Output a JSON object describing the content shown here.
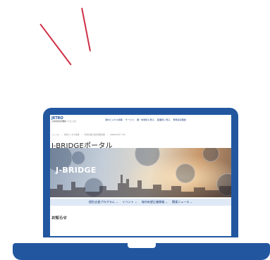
{
  "colors": {
    "accent": "#cf2e45",
    "laptop": "#2257a0",
    "nav_bar": "#dfe9f6"
  },
  "site": {
    "logo_subtitle": "日本貿易振興機構（ジェトロ）",
    "logo_mark": "JETRO",
    "main_nav": [
      "海外ビジネス情報",
      "サービス",
      "国・地域別に見る",
      "産業別に見る",
      "貿易投資相談"
    ],
    "breadcrumb": [
      "ジェトロ",
      "海外ビジネス情報",
      "日本企業の海外展開支援",
      "J-BRIDGEポータル"
    ],
    "page_title": "J-BRIDGEポータル",
    "hero_logo": "J-BRIDGE",
    "sub_nav": [
      "個別支援プログラム",
      "イベント",
      "海外有望企業情報",
      "関連ニュース"
    ],
    "news_heading": "お知らせ"
  }
}
